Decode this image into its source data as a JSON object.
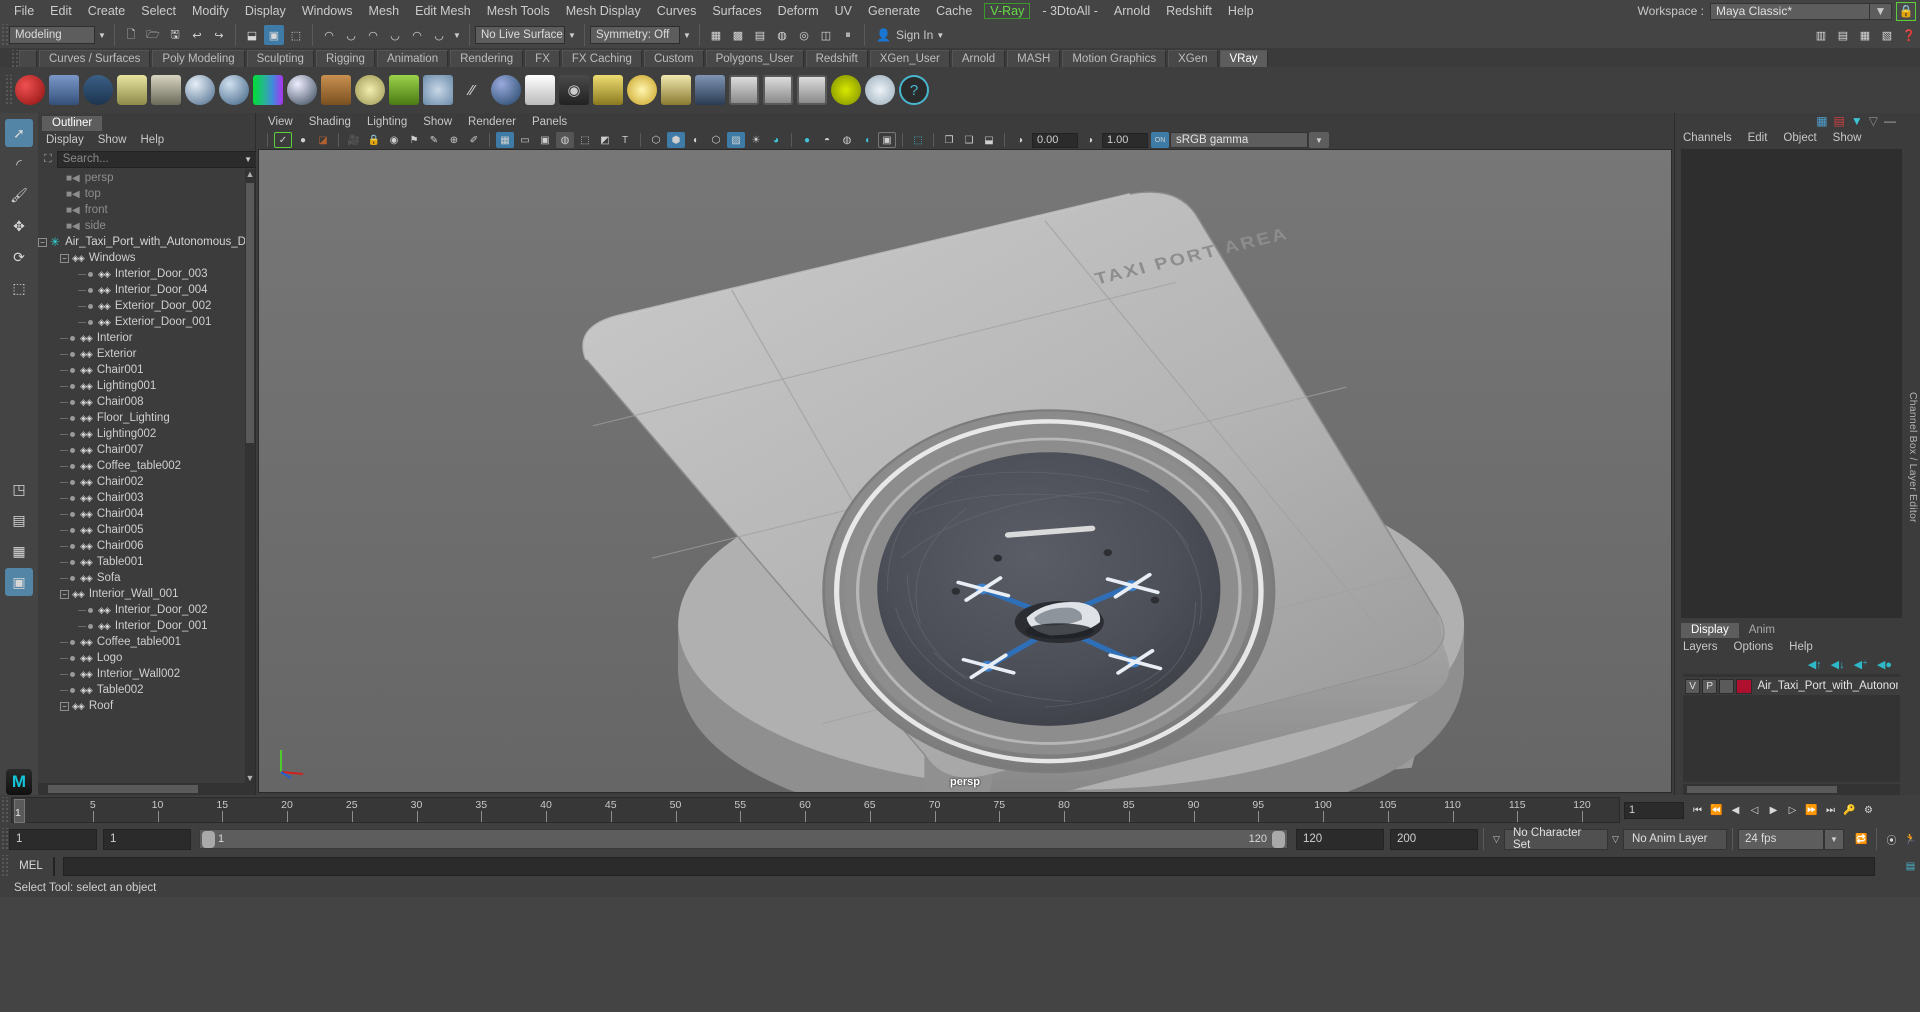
{
  "menubar": {
    "items": [
      "File",
      "Edit",
      "Create",
      "Select",
      "Modify",
      "Display",
      "Windows",
      "Mesh",
      "Edit Mesh",
      "Mesh Tools",
      "Mesh Display",
      "Curves",
      "Surfaces",
      "Deform",
      "UV",
      "Generate",
      "Cache"
    ],
    "vray": "V-Ray",
    "items_after": [
      "- 3DtoAll -",
      "Arnold",
      "Redshift",
      "Help"
    ],
    "workspace_label": "Workspace :",
    "workspace_value": "Maya Classic*",
    "lock_icon": "lock-icon"
  },
  "statusbar": {
    "mode_menu": "Modeling",
    "live_surface": "No Live Surface",
    "symmetry": "Symmetry: Off",
    "sign_in": "Sign In"
  },
  "shelf": {
    "tabs": [
      "Curves / Surfaces",
      "Poly Modeling",
      "Sculpting",
      "Rigging",
      "Animation",
      "Rendering",
      "FX",
      "FX Caching",
      "Custom",
      "Polygons_User",
      "Redshift",
      "XGen_User",
      "Arnold",
      "MASH",
      "Motion Graphics",
      "XGen",
      "VRay"
    ],
    "selected_tab": "VRay"
  },
  "outliner": {
    "tab": "Outliner",
    "menu": [
      "Display",
      "Show",
      "Help"
    ],
    "search_placeholder": "Search...",
    "items": [
      {
        "label": "persp",
        "type": "camera",
        "depth": 1
      },
      {
        "label": "top",
        "type": "camera",
        "depth": 1
      },
      {
        "label": "front",
        "type": "camera",
        "depth": 1
      },
      {
        "label": "side",
        "type": "camera",
        "depth": 1
      },
      {
        "label": "Air_Taxi_Port_with_Autonomous_Dron",
        "type": "root",
        "depth": 0
      },
      {
        "label": "Windows",
        "type": "group",
        "depth": 1
      },
      {
        "label": "Interior_Door_003",
        "type": "mesh",
        "depth": 2
      },
      {
        "label": "Interior_Door_004",
        "type": "mesh",
        "depth": 2
      },
      {
        "label": "Exterior_Door_002",
        "type": "mesh",
        "depth": 2
      },
      {
        "label": "Exterior_Door_001",
        "type": "mesh",
        "depth": 2
      },
      {
        "label": "Interior",
        "type": "mesh",
        "depth": 1
      },
      {
        "label": "Exterior",
        "type": "mesh",
        "depth": 1
      },
      {
        "label": "Chair001",
        "type": "mesh",
        "depth": 1
      },
      {
        "label": "Lighting001",
        "type": "mesh",
        "depth": 1
      },
      {
        "label": "Chair008",
        "type": "mesh",
        "depth": 1
      },
      {
        "label": "Floor_Lighting",
        "type": "mesh",
        "depth": 1
      },
      {
        "label": "Lighting002",
        "type": "mesh",
        "depth": 1
      },
      {
        "label": "Chair007",
        "type": "mesh",
        "depth": 1
      },
      {
        "label": "Coffee_table002",
        "type": "mesh",
        "depth": 1
      },
      {
        "label": "Chair002",
        "type": "mesh",
        "depth": 1
      },
      {
        "label": "Chair003",
        "type": "mesh",
        "depth": 1
      },
      {
        "label": "Chair004",
        "type": "mesh",
        "depth": 1
      },
      {
        "label": "Chair005",
        "type": "mesh",
        "depth": 1
      },
      {
        "label": "Chair006",
        "type": "mesh",
        "depth": 1
      },
      {
        "label": "Table001",
        "type": "mesh",
        "depth": 1
      },
      {
        "label": "Sofa",
        "type": "mesh",
        "depth": 1
      },
      {
        "label": "Interior_Wall_001",
        "type": "group",
        "depth": 1
      },
      {
        "label": "Interior_Door_002",
        "type": "mesh",
        "depth": 2
      },
      {
        "label": "Interior_Door_001",
        "type": "mesh",
        "depth": 2
      },
      {
        "label": "Coffee_table001",
        "type": "mesh",
        "depth": 1
      },
      {
        "label": "Logo",
        "type": "mesh",
        "depth": 1
      },
      {
        "label": "Interior_Wall002",
        "type": "mesh",
        "depth": 1
      },
      {
        "label": "Table002",
        "type": "mesh",
        "depth": 1
      },
      {
        "label": "Roof",
        "type": "group",
        "depth": 1
      }
    ]
  },
  "viewport": {
    "menu": [
      "View",
      "Shading",
      "Lighting",
      "Show",
      "Renderer",
      "Panels"
    ],
    "exposure": "0.00",
    "gamma": "1.00",
    "color_space": "sRGB gamma",
    "camera_label": "persp",
    "model_text": "TAXI PORT AREA"
  },
  "channelbox": {
    "menu": [
      "Channels",
      "Edit",
      "Object",
      "Show"
    ],
    "vertical_label": "Channel Box / Layer Editor"
  },
  "layereditor": {
    "tabs": [
      "Display",
      "Anim"
    ],
    "selected_tab": "Display",
    "menu": [
      "Layers",
      "Options",
      "Help"
    ],
    "layers": [
      {
        "visible": "V",
        "playback": "P",
        "color": "#b01030",
        "name": "Air_Taxi_Port_with_Autonomou"
      }
    ]
  },
  "timeline": {
    "ticks": [
      5,
      10,
      15,
      20,
      25,
      30,
      35,
      40,
      45,
      50,
      55,
      60,
      65,
      70,
      75,
      80,
      85,
      90,
      95,
      100,
      105,
      110,
      115,
      120
    ],
    "current_frame": "1",
    "end_display": "1"
  },
  "rangebar": {
    "start_field": "1",
    "anim_start_field": "1",
    "range_start": "1",
    "range_end": "120",
    "range_end_field": "120",
    "anim_end_field": "200",
    "character_set": "No Character Set",
    "anim_layer": "No Anim Layer",
    "fps": "24 fps"
  },
  "commandline": {
    "lang": "MEL",
    "input_value": "",
    "output_value": ""
  },
  "statusline": {
    "text": "Select Tool: select an object"
  },
  "colors": {
    "accent": "#5285a6",
    "highlight": "#3e7ba6",
    "green": "#66dd44",
    "cyan": "#2fd9d9",
    "layer_red": "#b01030"
  }
}
